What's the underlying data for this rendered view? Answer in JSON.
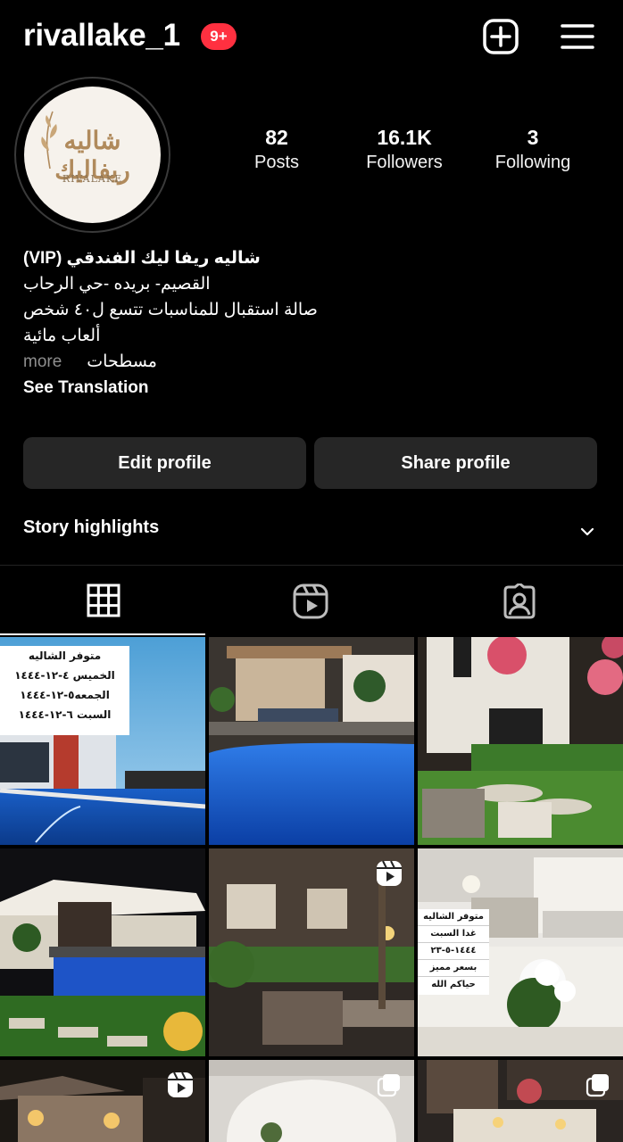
{
  "header": {
    "username": "rivallake_1",
    "notification_badge": "9+"
  },
  "avatar": {
    "logo_arabic": "شاليه ريفاليك",
    "logo_english": "RIVALAKE"
  },
  "stats": [
    {
      "value": "82",
      "label": "Posts"
    },
    {
      "value": "16.1K",
      "label": "Followers"
    },
    {
      "value": "3",
      "label": "Following"
    }
  ],
  "bio": {
    "name": "شاليه ريفا ليك الفندقي (VIP)",
    "line1": "القصيم- بريده -حي الرحاب",
    "line2": "صالة استقبال للمناسبات تتسع ل٤٠ شخص",
    "line3": "ألعاب مائية",
    "line4": "مسطحات",
    "more": "more",
    "see_translation": "See Translation"
  },
  "buttons": {
    "edit_profile": "Edit profile",
    "share_profile": "Share profile"
  },
  "highlights": {
    "label": "Story highlights"
  },
  "tabs": [
    {
      "icon": "grid-icon",
      "active": true
    },
    {
      "icon": "reels-icon",
      "active": false
    },
    {
      "icon": "tagged-icon",
      "active": false
    }
  ],
  "posts": {
    "post1_card": {
      "top": "متوفر الشاليه",
      "line1": "الخميس ٤-١٢-١٤٤٤",
      "line2": "الجمعه٥-١٢-١٤٤٤",
      "line3": "السبت ٦-١٢-١٤٤٤"
    },
    "post6_card": {
      "line1": "متوفر الشاليه",
      "line2": "غدا السبت",
      "line3": "١٤٤٤-٥-٢٣",
      "line4": "بسعر مميز",
      "line5": "حياكم الله"
    }
  },
  "colors": {
    "background": "#000000",
    "button_bg": "#262626",
    "badge": "#ff3040",
    "muted_text": "#8e8e8e"
  }
}
